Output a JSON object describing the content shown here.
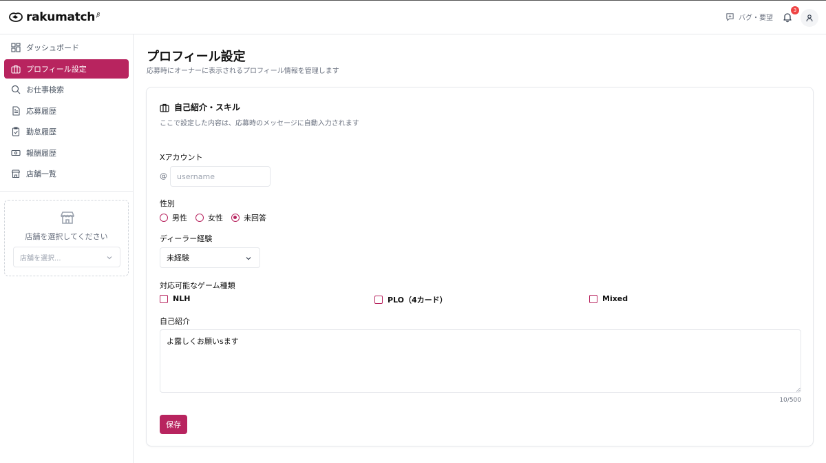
{
  "app": {
    "logo_text": "rakumatch",
    "logo_beta": "β"
  },
  "header": {
    "feedback_label": "バグ・要望",
    "notification_count": "3"
  },
  "sidebar": {
    "items": [
      {
        "label": "ダッシュボード",
        "icon": "grid-icon",
        "active": false
      },
      {
        "label": "プロフィール設定",
        "icon": "briefcase-icon",
        "active": true
      },
      {
        "label": "お仕事検索",
        "icon": "search-icon",
        "active": false
      },
      {
        "label": "応募履歴",
        "icon": "document-icon",
        "active": false
      },
      {
        "label": "勤怠履歴",
        "icon": "clipboard-check-icon",
        "active": false
      },
      {
        "label": "報酬履歴",
        "icon": "banknote-icon",
        "active": false
      },
      {
        "label": "店舗一覧",
        "icon": "store-icon",
        "active": false
      }
    ],
    "store_prompt": "店舗を選択してください",
    "store_select_placeholder": "店舗を選択..."
  },
  "page": {
    "title": "プロフィール設定",
    "subtitle": "応募時にオーナーに表示されるプロフィール情報を管理します"
  },
  "card": {
    "title": "自己紹介・スキル",
    "description": "ここで設定した内容は、応募時のメッセージに自動入力されます",
    "x_account": {
      "label": "Xアカウント",
      "prefix": "@",
      "placeholder": "username",
      "value": ""
    },
    "gender": {
      "label": "性別",
      "options": [
        "男性",
        "女性",
        "未回答"
      ],
      "selected": "未回答"
    },
    "dealer_experience": {
      "label": "ディーラー経験",
      "value": "未経験"
    },
    "games": {
      "label": "対応可能なゲーム種類",
      "options": [
        "NLH",
        "PLO（4カード）",
        "Mixed"
      ]
    },
    "bio": {
      "label": "自己紹介",
      "value": "よ露しくお願いsます",
      "counter": "10/500"
    },
    "save_label": "保存"
  },
  "colors": {
    "accent": "#b8245f",
    "badge": "#ef4444"
  }
}
